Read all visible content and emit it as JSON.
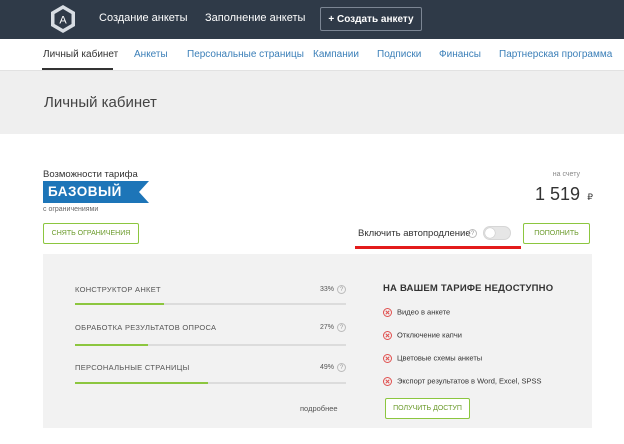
{
  "header": {
    "links": [
      "Создание анкеты",
      "Заполнение анкеты"
    ],
    "create_button": "+ Создать анкету",
    "logo_letter": "A"
  },
  "subnav": {
    "items": [
      "Личный кабинет",
      "Анкеты",
      "Персональные страницы",
      "Кампании",
      "Подписки",
      "Финансы",
      "Партнерская программа"
    ],
    "active_index": 0
  },
  "page": {
    "title": "Личный кабинет"
  },
  "tariff": {
    "label": "Возможности тарифа",
    "name": "БАЗОВЫЙ",
    "subtitle": "с ограничениями",
    "remove_limits_button": "СНЯТЬ ОГРАНИЧЕНИЯ"
  },
  "balance": {
    "label": "на счету",
    "value": "1 519",
    "currency": "₽",
    "topup_button": "ПОПОЛНИТЬ"
  },
  "autorenew": {
    "label": "Включить автопродление",
    "help": "?",
    "enabled": false
  },
  "features": {
    "items": [
      {
        "name": "КОНСТРУКТОР АНКЕТ",
        "percent_label": "33%",
        "percent": 33,
        "help": "?"
      },
      {
        "name": "ОБРАБОТКА РЕЗУЛЬТАТОВ ОПРОСА",
        "percent_label": "27%",
        "percent": 27,
        "help": "?"
      },
      {
        "name": "ПЕРСОНАЛЬНЫЕ СТРАНИЦЫ",
        "percent_label": "49%",
        "percent": 49,
        "help": "?"
      }
    ],
    "more_link": "подробнее"
  },
  "unavailable": {
    "title": "НА ВАШЕМ ТАРИФЕ НЕДОСТУПНО",
    "items": [
      "Видео в анкете",
      "Отключение капчи",
      "Цветовые схемы анкеты",
      "Экспорт результатов в Word, Excel, SPSS"
    ],
    "access_button": "ПОЛУЧИТЬ ДОСТУП"
  },
  "colors": {
    "header_bg": "#2f3a48",
    "link": "#3b7fb8",
    "accent_green": "#8cc63f",
    "badge_blue": "#1d75b8",
    "highlight_red": "#e31b1b",
    "error_red": "#e0504f"
  },
  "icons": {
    "logo": "logo-icon",
    "help": "help-circle-icon",
    "unavailable": "x-circle-icon"
  }
}
